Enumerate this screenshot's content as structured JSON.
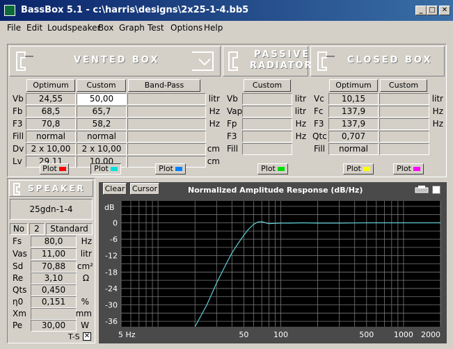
{
  "window": {
    "title": "BassBox 5.1 - c:\\harris\\designs\\2x25-1-4.bb5"
  },
  "menu": [
    "File",
    "Edit",
    "Loudspeaker",
    "Box",
    "Graph",
    "Test",
    "Options",
    "Help"
  ],
  "vented": {
    "header": "VENTED BOX",
    "buttons": {
      "optimum": "Optimum",
      "custom": "Custom",
      "bandpass": "Band-Pass"
    },
    "rows": [
      {
        "label": "Vb",
        "opt": "24,55",
        "cust": "50,00",
        "unit": "litr"
      },
      {
        "label": "Fb",
        "opt": "68,5",
        "cust": "65,7",
        "unit": "Hz"
      },
      {
        "label": "F3",
        "opt": "70,8",
        "cust": "58,2",
        "unit": "Hz"
      },
      {
        "label": "Fill",
        "opt": "normal",
        "cust": "normal",
        "unit": ""
      },
      {
        "label": "Dv",
        "opt": "2 x 10,00",
        "cust": "2 x 10,00",
        "unit": "cm"
      },
      {
        "label": "Lv",
        "opt": "29,11",
        "cust": "10,00",
        "unit": "cm"
      }
    ],
    "plot_label": "Plot"
  },
  "passive": {
    "header_line1": "PASSIVE",
    "header_line2": "RADIATOR",
    "button": "Custom",
    "labels": [
      "Vb",
      "Vap",
      "Fp",
      "F3",
      "Fill"
    ],
    "units": [
      "litr",
      "litr",
      "Hz",
      "Hz",
      ""
    ],
    "plot_label": "Plot"
  },
  "closed": {
    "header": "CLOSED BOX",
    "buttons": {
      "optimum": "Optimum",
      "custom": "Custom"
    },
    "rows": [
      {
        "label": "Vc",
        "opt": "10,15",
        "unit": "litr"
      },
      {
        "label": "Fc",
        "opt": "137,9",
        "unit": "Hz"
      },
      {
        "label": "F3",
        "opt": "137,9",
        "unit": "Hz"
      },
      {
        "label": "Qtc",
        "opt": "0,707",
        "unit": ""
      },
      {
        "label": "Fill",
        "opt": "normal",
        "unit": ""
      }
    ],
    "plot_label": "Plot"
  },
  "speaker": {
    "header": "SPEAKER",
    "name": "25gdn-1-4",
    "no_label": "No",
    "no_value": "2",
    "mode": "Standard",
    "rows": [
      {
        "label": "Fs",
        "value": "80,0",
        "unit": "Hz"
      },
      {
        "label": "Vas",
        "value": "11,00",
        "unit": "litr"
      },
      {
        "label": "Sd",
        "value": "70,88",
        "unit": "cm²"
      },
      {
        "label": "Re",
        "value": "3,10",
        "unit": "Ω"
      },
      {
        "label": "Qts",
        "value": "0,450",
        "unit": ""
      },
      {
        "label": "η0",
        "value": "0,151",
        "unit": "%"
      },
      {
        "label": "Xm",
        "value": "",
        "unit": "mm"
      },
      {
        "label": "Pe",
        "value": "30,00",
        "unit": "W"
      }
    ],
    "ts_label": "T-S"
  },
  "graph": {
    "clear": "Clear",
    "cursor": "Cursor",
    "title": "Normalized Amplitude Response (dB/Hz)"
  },
  "chart_data": {
    "type": "line",
    "title": "Normalized Amplitude Response (dB/Hz)",
    "xlabel": "",
    "ylabel": "dB",
    "x_scale": "log",
    "xlim": [
      5,
      2000
    ],
    "ylim": [
      -38,
      8
    ],
    "xticks": [
      5,
      50,
      100,
      500,
      1000,
      2000
    ],
    "xtick_labels": [
      "5 Hz",
      "50",
      "100",
      "500",
      "1000",
      "2000"
    ],
    "yticks": [
      0,
      -6,
      -12,
      -18,
      -24,
      -30,
      -36
    ],
    "ytick_labels": [
      "0",
      "-6",
      "-12",
      "-18",
      "-24",
      "-30",
      "-36"
    ],
    "grid": true,
    "series": [
      {
        "color": "#5fd0d8",
        "x": [
          20,
          25,
          30,
          35,
          40,
          45,
          50,
          55,
          60,
          65,
          70,
          75,
          80,
          90,
          100,
          120,
          150,
          200,
          300,
          500,
          1000,
          2000
        ],
        "y": [
          -38,
          -30,
          -22,
          -16,
          -11,
          -7.5,
          -4.5,
          -2.2,
          -0.6,
          0.3,
          0.4,
          0,
          -0.3,
          -0.2,
          -0.1,
          -0.1,
          0,
          -0.1,
          -0.1,
          0,
          0,
          0
        ]
      }
    ]
  },
  "colors": {
    "vented_plot": "#ff0000",
    "vented_custom_plot": "#00e0e0",
    "bandpass_plot": "#0080ff",
    "passive_plot": "#00e000",
    "closed_plot": "#ffff00",
    "closed_custom_plot": "#ff00ff"
  }
}
